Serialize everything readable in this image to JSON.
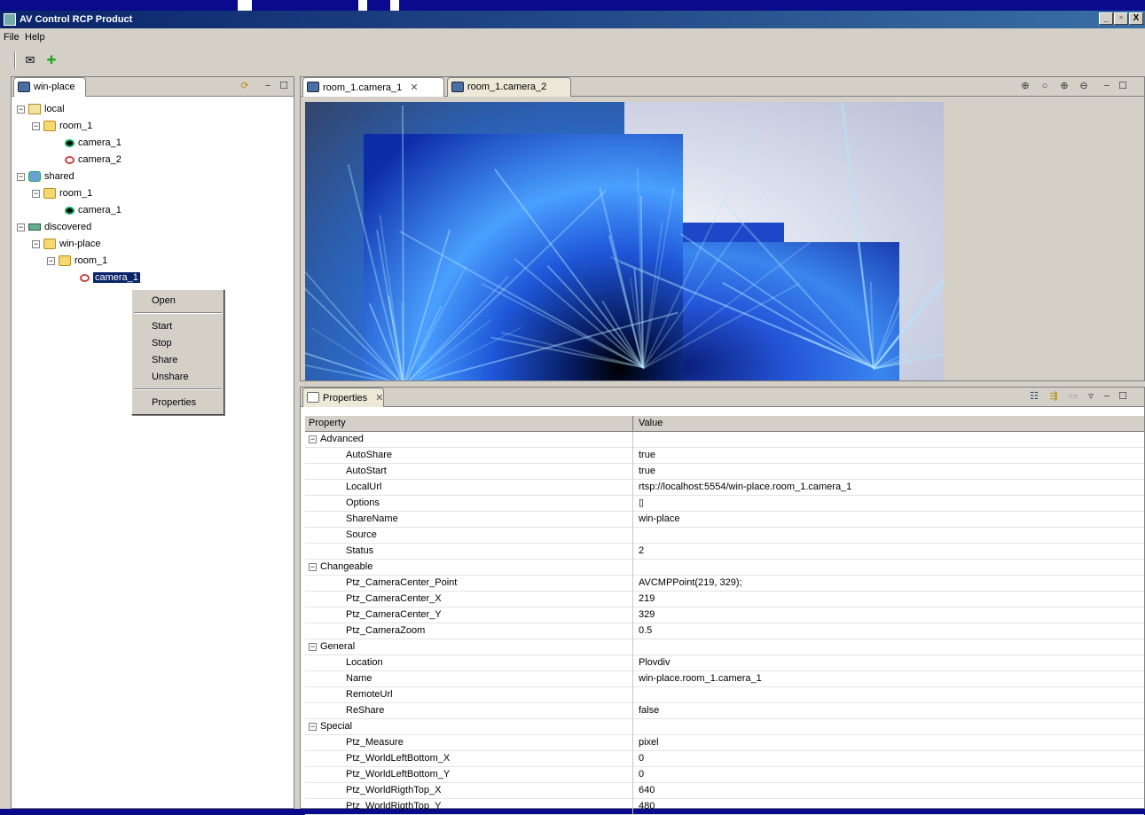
{
  "window": {
    "title": "AV Control RCP Product",
    "min_label": "_",
    "max_label": "▫",
    "close_label": "X"
  },
  "menu": {
    "file": "File",
    "help": "Help"
  },
  "toolbar": {
    "mail_glyph": "✉",
    "add_glyph": "✚"
  },
  "tree_view": {
    "tab_label": "win-place",
    "nodes": [
      {
        "label": "local",
        "depth": 0,
        "icon": "home-icon",
        "expander": "−"
      },
      {
        "label": "room_1",
        "depth": 1,
        "icon": "folder-icon",
        "expander": "−"
      },
      {
        "label": "camera_1",
        "depth": 2,
        "icon": "camera-on-icon",
        "expander": ""
      },
      {
        "label": "camera_2",
        "depth": 2,
        "icon": "camera-off-icon",
        "expander": ""
      },
      {
        "label": "shared",
        "depth": 0,
        "icon": "shared-icon",
        "expander": "−"
      },
      {
        "label": "room_1",
        "depth": 1,
        "icon": "folder-icon",
        "expander": "−"
      },
      {
        "label": "camera_1",
        "depth": 2,
        "icon": "camera-on-icon",
        "expander": ""
      },
      {
        "label": "discovered",
        "depth": 0,
        "icon": "network-icon",
        "expander": "−"
      },
      {
        "label": "win-place",
        "depth": 1,
        "icon": "folder-icon",
        "expander": "−"
      },
      {
        "label": "room_1",
        "depth": 2,
        "icon": "folder-icon",
        "expander": "−"
      },
      {
        "label": "camera_1",
        "depth": 3,
        "icon": "camera-off-icon",
        "expander": "",
        "selected": true
      }
    ]
  },
  "context_menu": {
    "items": [
      "Open",
      "Start",
      "Stop",
      "Share",
      "Unshare",
      "Properties"
    ]
  },
  "editor": {
    "tabs": [
      {
        "label": "room_1.camera_1",
        "close": "✕"
      },
      {
        "label": "room_1.camera_2"
      }
    ]
  },
  "properties": {
    "tab_label": "Properties",
    "tab_close": "✕",
    "col_property": "Property",
    "col_value": "Value",
    "rows": [
      {
        "type": "cat",
        "name": "Advanced",
        "value": ""
      },
      {
        "type": "leaf",
        "name": "AutoShare",
        "value": "true"
      },
      {
        "type": "leaf",
        "name": "AutoStart",
        "value": "true"
      },
      {
        "type": "leaf",
        "name": "LocalUrl",
        "value": "rtsp://localhost:5554/win-place.room_1.camera_1"
      },
      {
        "type": "leaf",
        "name": "Options",
        "value": "▯"
      },
      {
        "type": "leaf",
        "name": "ShareName",
        "value": "win-place"
      },
      {
        "type": "leaf",
        "name": "Source",
        "value": ""
      },
      {
        "type": "leaf",
        "name": "Status",
        "value": "2"
      },
      {
        "type": "cat",
        "name": "Changeable",
        "value": ""
      },
      {
        "type": "leaf",
        "name": "Ptz_CameraCenter_Point",
        "value": "AVCMPPoint(219, 329);"
      },
      {
        "type": "leaf",
        "name": "Ptz_CameraCenter_X",
        "value": "219"
      },
      {
        "type": "leaf",
        "name": "Ptz_CameraCenter_Y",
        "value": "329"
      },
      {
        "type": "leaf",
        "name": "Ptz_CameraZoom",
        "value": "0.5"
      },
      {
        "type": "cat",
        "name": "General",
        "value": ""
      },
      {
        "type": "leaf",
        "name": "Location",
        "value": "Plovdiv"
      },
      {
        "type": "leaf",
        "name": "Name",
        "value": "win-place.room_1.camera_1"
      },
      {
        "type": "leaf",
        "name": "RemoteUrl",
        "value": ""
      },
      {
        "type": "leaf",
        "name": "ReShare",
        "value": "false"
      },
      {
        "type": "cat",
        "name": "Special",
        "value": ""
      },
      {
        "type": "leaf",
        "name": "Ptz_Measure",
        "value": "pixel"
      },
      {
        "type": "leaf",
        "name": "Ptz_WorldLeftBottom_X",
        "value": "0"
      },
      {
        "type": "leaf",
        "name": "Ptz_WorldLeftBottom_Y",
        "value": "0"
      },
      {
        "type": "leaf",
        "name": "Ptz_WorldRigthTop_X",
        "value": "640"
      },
      {
        "type": "leaf",
        "name": "Ptz_WorldRigthTop_Y",
        "value": "480"
      }
    ]
  }
}
